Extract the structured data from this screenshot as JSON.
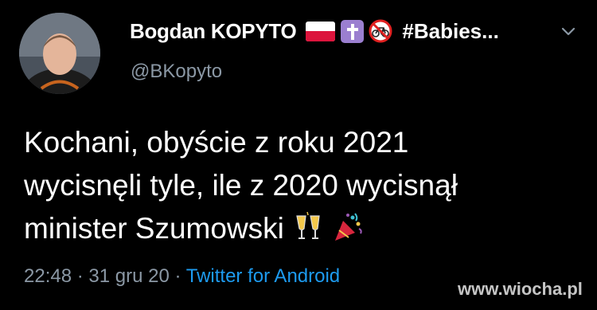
{
  "author": {
    "display_name": "Bogdan KOPYTO",
    "tag_text": "#Babies...",
    "handle": "@BKopyto",
    "badges": [
      "poland-flag-icon",
      "latin-cross-icon",
      "no-bicycles-icon"
    ]
  },
  "tweet": {
    "lines": [
      "Kochani, obyście z roku 2021",
      "wycisnęli tyle, ile z 2020 wycisnął",
      "ministerSzumowski"
    ],
    "line3_text": "minister Szumowski",
    "emojis": [
      "clinking-glasses-icon",
      "party-popper-icon"
    ]
  },
  "meta": {
    "time": "22:48",
    "separator": "·",
    "date": "31 gru 20",
    "source": "Twitter for Android"
  },
  "watermark": "www.wiocha.pl",
  "colors": {
    "background": "#000000",
    "text": "#ffffff",
    "secondary": "#8b98a5",
    "link": "#1d9bf0"
  }
}
